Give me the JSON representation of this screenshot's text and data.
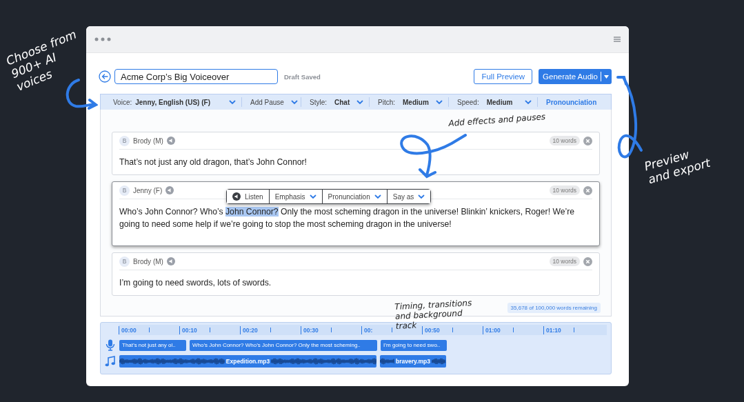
{
  "header": {
    "title_value": "Acme Corp’s Big Voiceover",
    "status": "Draft Saved",
    "preview_button": "Full Preview",
    "generate_button": "Generate Audio"
  },
  "toolbar": [
    {
      "kind": "dropdown",
      "label": "Voice:",
      "value": "Jenny, English (US) (F)"
    },
    {
      "kind": "dropdown",
      "label": "Add Pause"
    },
    {
      "kind": "dropdown",
      "label": "Style:",
      "value": "Chat"
    },
    {
      "kind": "dropdown",
      "label": "Pitch:",
      "value": "Medium"
    },
    {
      "kind": "dropdown",
      "label": "Speed:",
      "value": "Medium"
    },
    {
      "kind": "link",
      "label": "Pronounciation"
    }
  ],
  "blocks": [
    {
      "avatar": "B",
      "speaker": "Brody (M)",
      "word_count": "10 words",
      "selected": false,
      "segments": [
        {
          "text": "That’s not just any old dragon, that’s John Connor!",
          "highlighted": false
        }
      ]
    },
    {
      "avatar": "B",
      "speaker": "Jenny (F)",
      "word_count": "10 words",
      "selected": true,
      "segments": [
        {
          "text": "Who’s John Connor? Who’s ",
          "highlighted": false
        },
        {
          "text": "John Connor?",
          "highlighted": true
        },
        {
          "text": " Only the most scheming dragon in the universe! Blinkin’ knickers, Roger! We’re going to need some help if we’re going to stop the most scheming dragon in the universe!",
          "highlighted": false
        }
      ],
      "selection_menu": [
        {
          "kind": "button",
          "label": "Listen"
        },
        {
          "kind": "dropdown",
          "label": "Emphasis"
        },
        {
          "kind": "dropdown",
          "label": "Pronunciation"
        },
        {
          "kind": "dropdown",
          "label": "Say as"
        }
      ]
    },
    {
      "avatar": "B",
      "speaker": "Brody (M)",
      "word_count": "10 words",
      "selected": false,
      "segments": [
        {
          "text": "I’m going to need swords, lots of swords.",
          "highlighted": false
        }
      ]
    }
  ],
  "words_remaining": "35,678 of 100,000 words remaining",
  "timeline": {
    "ticks": [
      "00:00",
      "00:10",
      "00:20",
      "00:30",
      "00:",
      "00:50",
      "01:00",
      "01:10"
    ],
    "speech_clips": [
      "That’s not just any ol..",
      "Who’s John Connor? Who’s John Connor? Only the most scheming..",
      "I’m going to need swo.."
    ],
    "music_clips": [
      "Expedition.mp3",
      "bravery.mp3"
    ]
  },
  "annotations": [
    {
      "kind": "light",
      "text": "Choose from\n900+ AI\nvoices"
    },
    {
      "kind": "dark",
      "text": "Add effects\nand pauses"
    },
    {
      "kind": "light",
      "text": "Preview\nand export"
    },
    {
      "kind": "dark",
      "text": "Timing, transitions\nand background\ntrack"
    }
  ]
}
